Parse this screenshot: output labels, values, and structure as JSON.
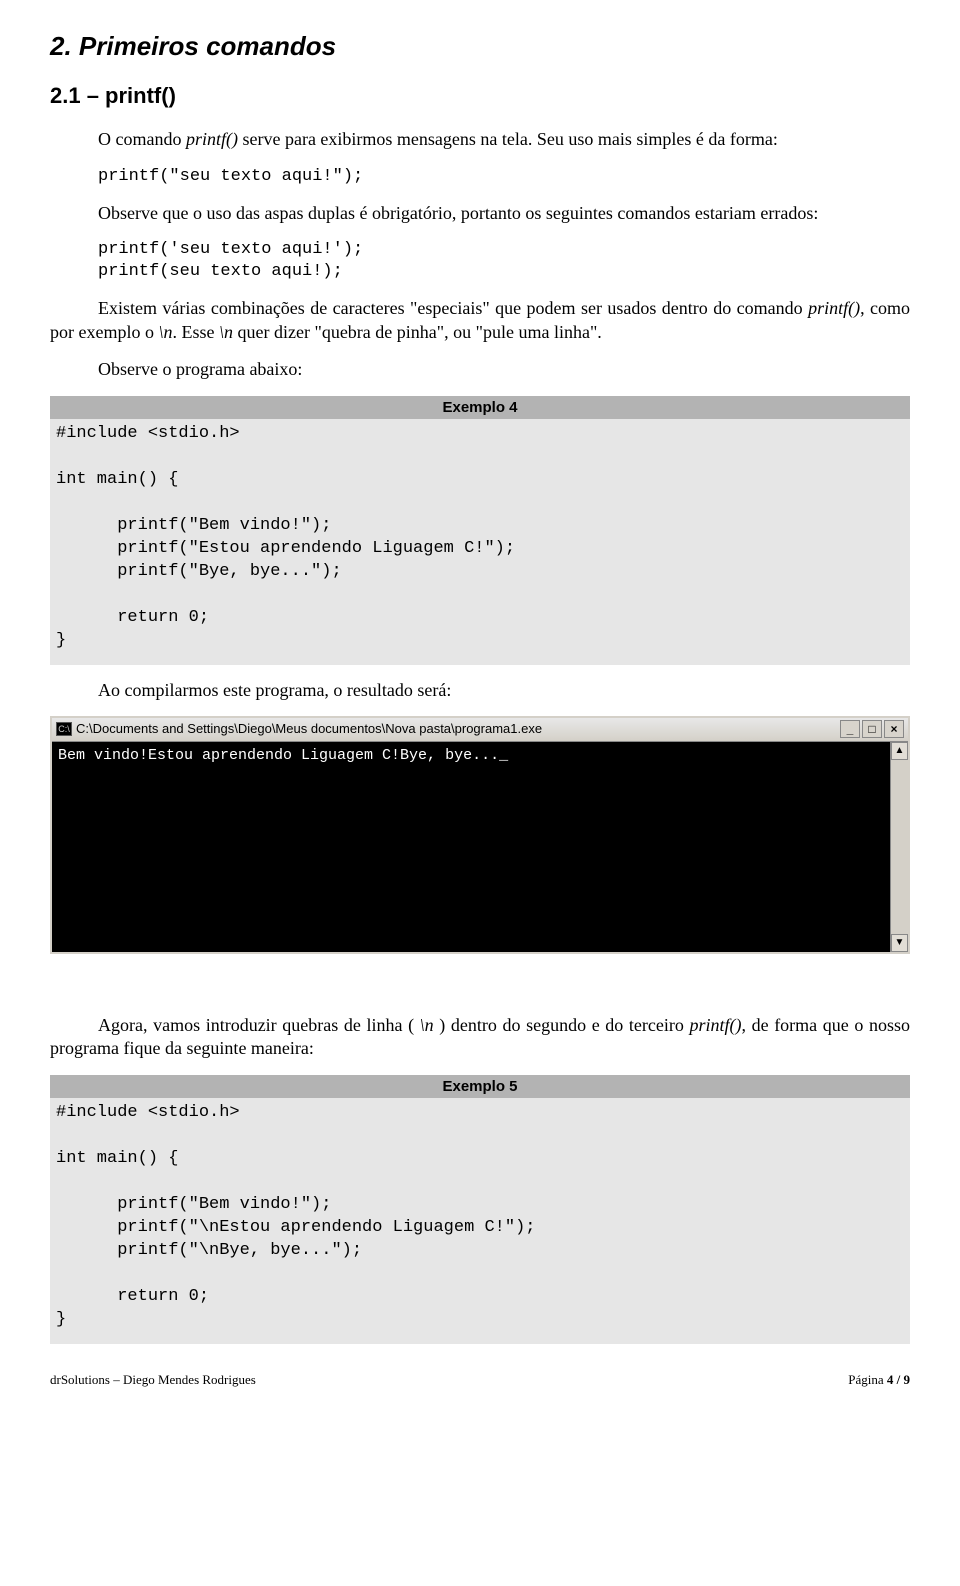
{
  "headings": {
    "section": "2. Primeiros comandos",
    "subsection": "2.1 – printf()"
  },
  "para": {
    "p1a": "O comando ",
    "p1b": "printf()",
    "p1c": " serve para exibirmos mensagens na tela. Seu uso mais simples é da forma:",
    "code1": "printf(\"seu texto aqui!\");",
    "p2": "Observe que o uso das aspas duplas é obrigatório, portanto os seguintes comandos estariam errados:",
    "code2a": "printf('seu texto aqui!');",
    "code2b": "printf(seu texto aqui!);",
    "p3a": "Existem várias combinações de caracteres \"especiais\" que podem ser usados dentro do comando ",
    "p3b": "printf()",
    "p3c": ", como por exemplo o ",
    "p3d": "\\n",
    "p3e": ". Esse ",
    "p3f": "\\n",
    "p3g": " quer dizer \"quebra de pinha\", ou \"pule uma linha\".",
    "p4": "Observe o programa abaixo:",
    "p5": "Ao compilarmos este programa, o resultado será:",
    "p6a": "Agora, vamos introduzir quebras de linha ( ",
    "p6b": "\\n",
    "p6c": " ) dentro do segundo e do terceiro ",
    "p6d": "printf()",
    "p6e": ", de forma que o nosso programa fique da seguinte maneira:"
  },
  "example4": {
    "label": "Exemplo 4",
    "code": "#include <stdio.h>\n\nint main() {\n\n      printf(\"Bem vindo!\");\n      printf(\"Estou aprendendo Liguagem C!\");\n      printf(\"Bye, bye...\");\n\n      return 0;\n}"
  },
  "terminal": {
    "title": "C:\\Documents and Settings\\Diego\\Meus documentos\\Nova pasta\\programa1.exe",
    "output": "Bem vindo!Estou aprendendo Liguagem C!Bye, bye..._",
    "icon_text": "C:\\",
    "btn_min": "_",
    "btn_max": "□",
    "btn_close": "×",
    "scroll_up": "▲",
    "scroll_down": "▼"
  },
  "example5": {
    "label": "Exemplo 5",
    "code": "#include <stdio.h>\n\nint main() {\n\n      printf(\"Bem vindo!\");\n      printf(\"\\nEstou aprendendo Liguagem C!\");\n      printf(\"\\nBye, bye...\");\n\n      return 0;\n}"
  },
  "footer": {
    "left": "drSolutions – Diego Mendes Rodrigues",
    "right_label": "Página ",
    "right_value": "4 / 9"
  }
}
